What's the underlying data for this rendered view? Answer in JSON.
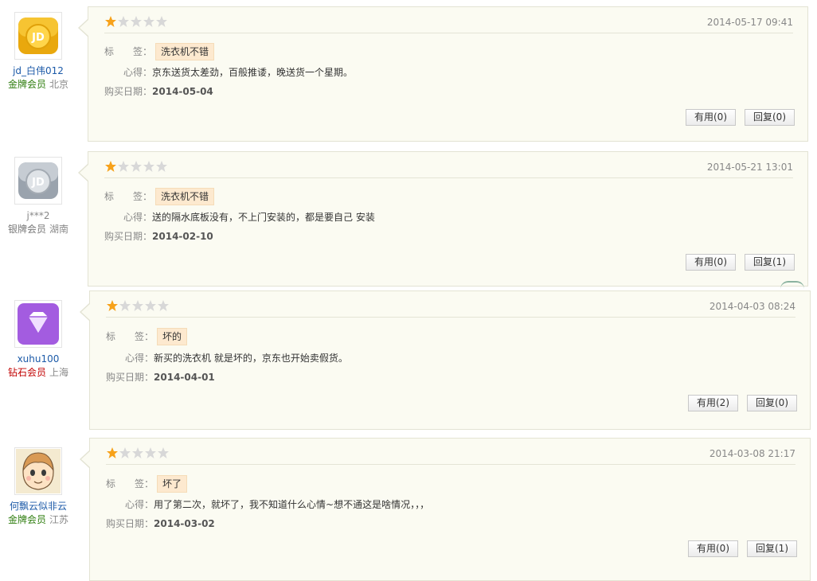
{
  "reviews": [
    {
      "user_name": "jd_白伟012",
      "level": "金牌会员",
      "location": "北京",
      "avatar_icon": "jd-gold-avatar-icon",
      "rating": 1,
      "date": "2014-05-17 09:41",
      "tag_label": "标　　签：",
      "tag": "洗衣机不错",
      "content_label": "心得：",
      "content": "京东送货太差劲，百般推诿，晚送货一个星期。",
      "purchase_label": "购买日期：",
      "purchase_date": "2014-05-04",
      "useful": "有用(0)",
      "reply": "回复(0)"
    },
    {
      "user_name": "j***2",
      "level": "银牌会员",
      "location": "湖南",
      "avatar_icon": "jd-silver-avatar-icon",
      "rating": 1,
      "date": "2014-05-21 13:01",
      "tag_label": "标　　签：",
      "tag": "洗衣机不错",
      "content_label": "心得：",
      "content": "送的隔水底板没有，不上门安装的，都是要自己 安装",
      "purchase_label": "购买日期：",
      "purchase_date": "2014-02-10",
      "useful": "有用(0)",
      "reply": "回复(1)"
    },
    {
      "user_name": "xuhu100",
      "level": "钻石会员",
      "location": "上海",
      "avatar_icon": "diamond-avatar-icon",
      "rating": 1,
      "date": "2014-04-03 08:24",
      "tag_label": "标　　签：",
      "tag": "坏的",
      "content_label": "心得：",
      "content": "新买的洗衣机 就是坏的，京东也开始卖假货。",
      "purchase_label": "购买日期：",
      "purchase_date": "2014-04-01",
      "useful": "有用(2)",
      "reply": "回复(0)"
    },
    {
      "user_name": "何飘云似非云",
      "level": "金牌会员",
      "location": "江苏",
      "avatar_icon": "cartoon-face-avatar-icon",
      "rating": 1,
      "date": "2014-03-08 21:17",
      "tag_label": "标　　签：",
      "tag": "坏了",
      "content_label": "心得：",
      "content": "用了第二次，就坏了，我不知道什么心情~想不通这是啥情况，，，",
      "purchase_label": "购买日期：",
      "purchase_date": "2014-03-02",
      "useful": "有用(0)",
      "reply": "回复(1)"
    }
  ],
  "colors": {
    "star_on": "#f7a21b",
    "star_off": "#d8d8d8",
    "tag_bg": "#fde9cf",
    "gold_level": "#2e7d0e",
    "diamond_level": "#c10000",
    "username_blue": "#1c5aa8"
  }
}
